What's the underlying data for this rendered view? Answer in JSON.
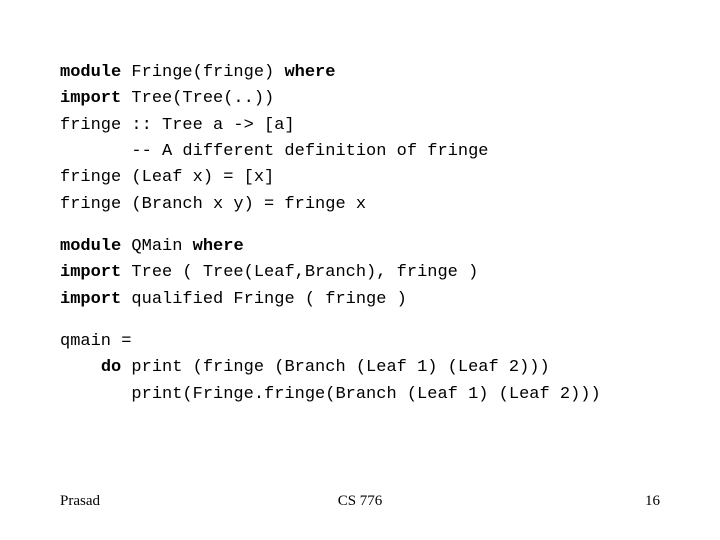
{
  "block1": {
    "l1": {
      "kw": "module",
      "rest": " Fringe(fringe) ",
      "kw2": "where"
    },
    "l2": {
      "kw": "import",
      "rest": " Tree(Tree(..))"
    },
    "l3": "fringe :: Tree a -> [a]",
    "l4": "       -- A different definition of fringe",
    "l5": "fringe (Leaf x) = [x]",
    "l6": "fringe (Branch x y) = fringe x"
  },
  "block2": {
    "l1": {
      "kw": "module",
      "rest": " QMain ",
      "kw2": "where"
    },
    "l2": {
      "kw": "import",
      "rest": " Tree ( Tree(Leaf,Branch), fringe )"
    },
    "l3": {
      "kw": "import",
      "rest": " qualified Fringe ( fringe )"
    }
  },
  "block3": {
    "l1": "qmain =",
    "l2": {
      "indent": "    ",
      "kw": "do",
      "rest": " print (fringe (Branch (Leaf 1) (Leaf 2)))"
    },
    "l3": "       print(Fringe.fringe(Branch (Leaf 1) (Leaf 2)))"
  },
  "footer": {
    "left": "Prasad",
    "center": "CS 776",
    "right": "16"
  }
}
